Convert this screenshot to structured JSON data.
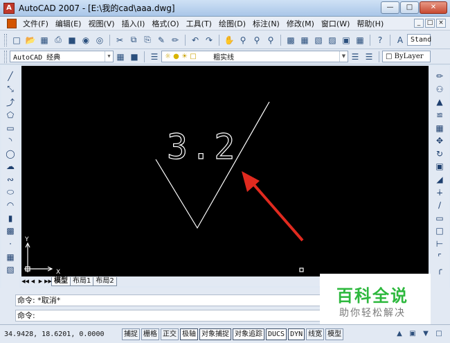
{
  "window": {
    "title": "AutoCAD 2007 - [E:\\我的cad\\aaa.dwg]",
    "controls": [
      "minimize",
      "maximize",
      "close"
    ]
  },
  "menubar": {
    "items": [
      "文件(F)",
      "编辑(E)",
      "视图(V)",
      "插入(I)",
      "格式(O)",
      "工具(T)",
      "绘图(D)",
      "标注(N)",
      "修改(M)",
      "窗口(W)",
      "帮助(H)"
    ]
  },
  "toolbar_standard": {
    "text_style_value": "Stand"
  },
  "toolbar_workspace": {
    "workspace_value": "AutoCAD 经典",
    "layer_value": "粗实线",
    "color_value": "ByLayer"
  },
  "drawing": {
    "text": "3.2",
    "ucs_x": "X",
    "ucs_y": "Y",
    "colors": {
      "background": "#000000",
      "lines": "#ffffff",
      "arrow": "#e02a1f"
    }
  },
  "layout_tabs": [
    "模型",
    "布局1",
    "布局2"
  ],
  "command_line": {
    "history": "命令: *取消*",
    "prompt": "命令:"
  },
  "status_bar": {
    "coordinates": "34.9428, 18.6201, 0.0000",
    "toggles": [
      "捕捉",
      "栅格",
      "正交",
      "极轴",
      "对象捕捉",
      "对象追踪",
      "DUCS",
      "DYN",
      "线宽",
      "模型"
    ]
  },
  "watermark": {
    "title": "百科全说",
    "subtitle": "助你轻松解决"
  }
}
